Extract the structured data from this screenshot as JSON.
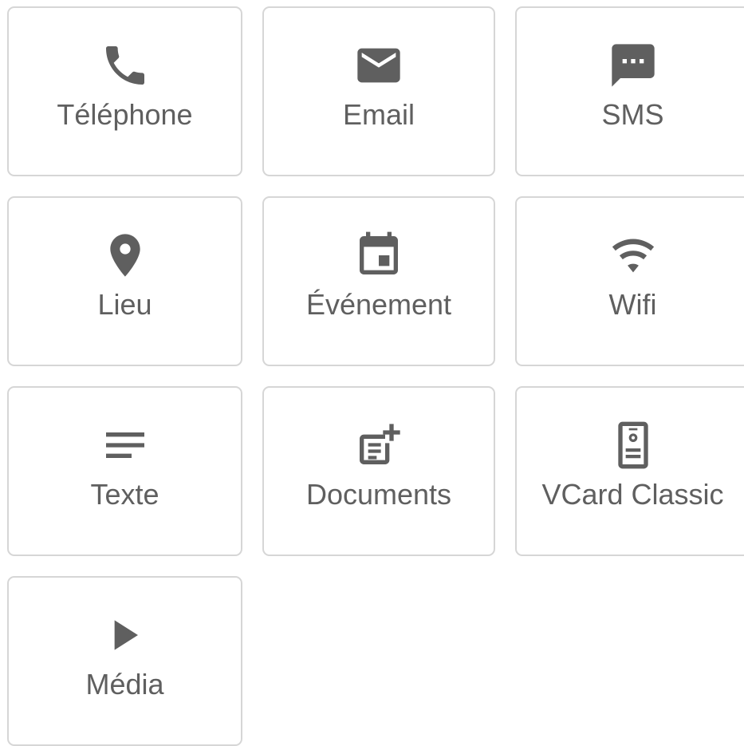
{
  "tiles": [
    {
      "label": "Téléphone",
      "icon": "phone-icon"
    },
    {
      "label": "Email",
      "icon": "email-icon"
    },
    {
      "label": "SMS",
      "icon": "sms-icon"
    },
    {
      "label": "Lieu",
      "icon": "location-pin-icon"
    },
    {
      "label": "Événement",
      "icon": "calendar-event-icon"
    },
    {
      "label": "Wifi",
      "icon": "wifi-icon"
    },
    {
      "label": "Texte",
      "icon": "text-lines-icon"
    },
    {
      "label": "Documents",
      "icon": "document-add-icon"
    },
    {
      "label": "VCard Classic",
      "icon": "vcard-phone-icon"
    },
    {
      "label": "Média",
      "icon": "play-icon"
    }
  ],
  "colors": {
    "icon": "#5f5f5f",
    "text": "#5f5f5f",
    "border": "#d6d6d6",
    "background": "#ffffff"
  }
}
